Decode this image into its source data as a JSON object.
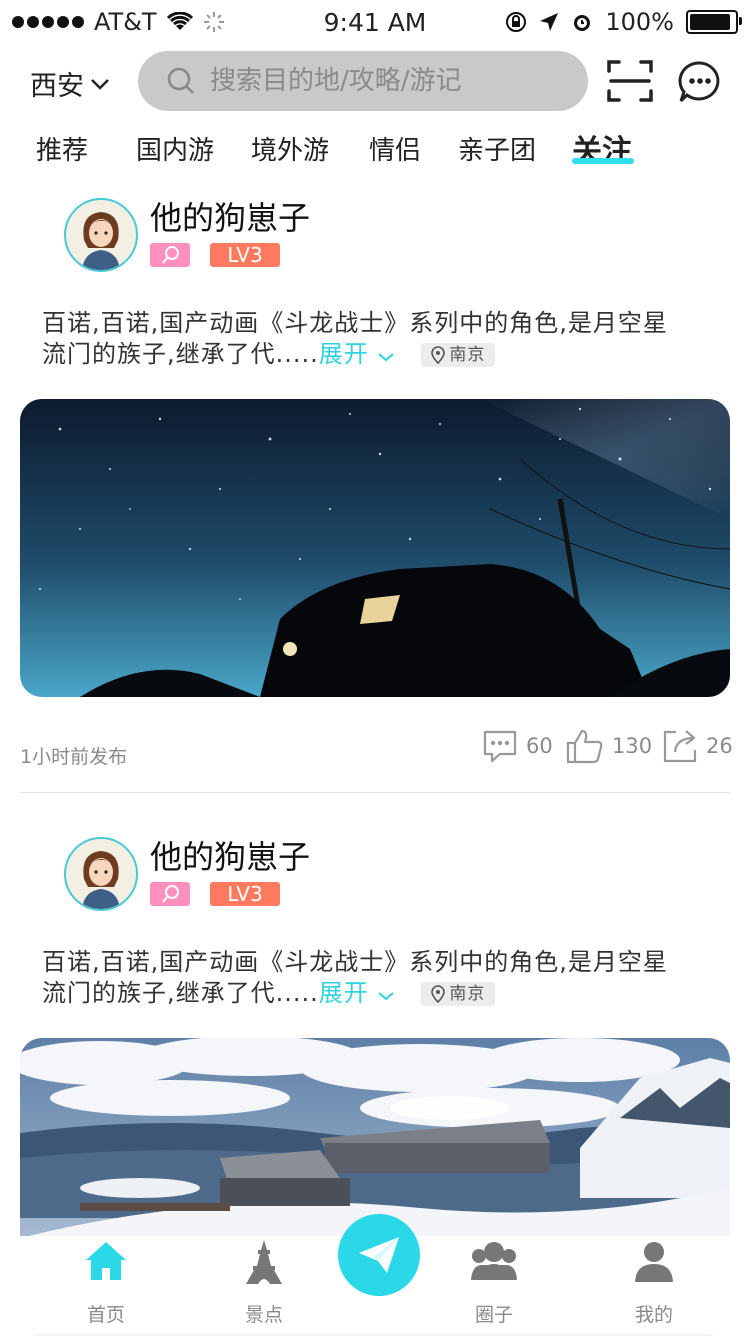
{
  "status_bar": {
    "carrier": "AT&T",
    "time": "9:41 AM",
    "battery": "100%",
    "battery_level": 1.0
  },
  "header": {
    "city": "西安",
    "search_placeholder": "搜索目的地/攻略/游记"
  },
  "tabs": [
    {
      "label": "推荐"
    },
    {
      "label": "国内游"
    },
    {
      "label": "境外游"
    },
    {
      "label": "情侣"
    },
    {
      "label": "亲子团"
    },
    {
      "label": "关注",
      "active": true
    }
  ],
  "posts": [
    {
      "username": "他的狗崽子",
      "level": "LV3",
      "desc_line1": "百诺,百诺,国产动画《斗龙战士》系列中的角色,是月空星",
      "desc_line2": "流门的族子,继承了代.....",
      "expand": "展开",
      "location": "南京",
      "time": "1小时前发布",
      "comments": "60",
      "likes": "130",
      "shares": "26"
    },
    {
      "username": "他的狗崽子",
      "level": "LV3",
      "desc_line1": "百诺,百诺,国产动画《斗龙战士》系列中的角色,是月空星",
      "desc_line2": "流门的族子,继承了代.....",
      "expand": "展开",
      "location": "南京"
    }
  ],
  "bottom_nav": [
    {
      "label": "首页",
      "icon": "home-icon",
      "active": true
    },
    {
      "label": "景点",
      "icon": "tower-icon"
    },
    {
      "label": "圈子",
      "icon": "group-icon"
    },
    {
      "label": "我的",
      "icon": "user-icon"
    }
  ],
  "colors": {
    "accent": "#2bd8e8",
    "badge_gender": "#ff8fbd",
    "badge_level": "#ff7a5e"
  }
}
